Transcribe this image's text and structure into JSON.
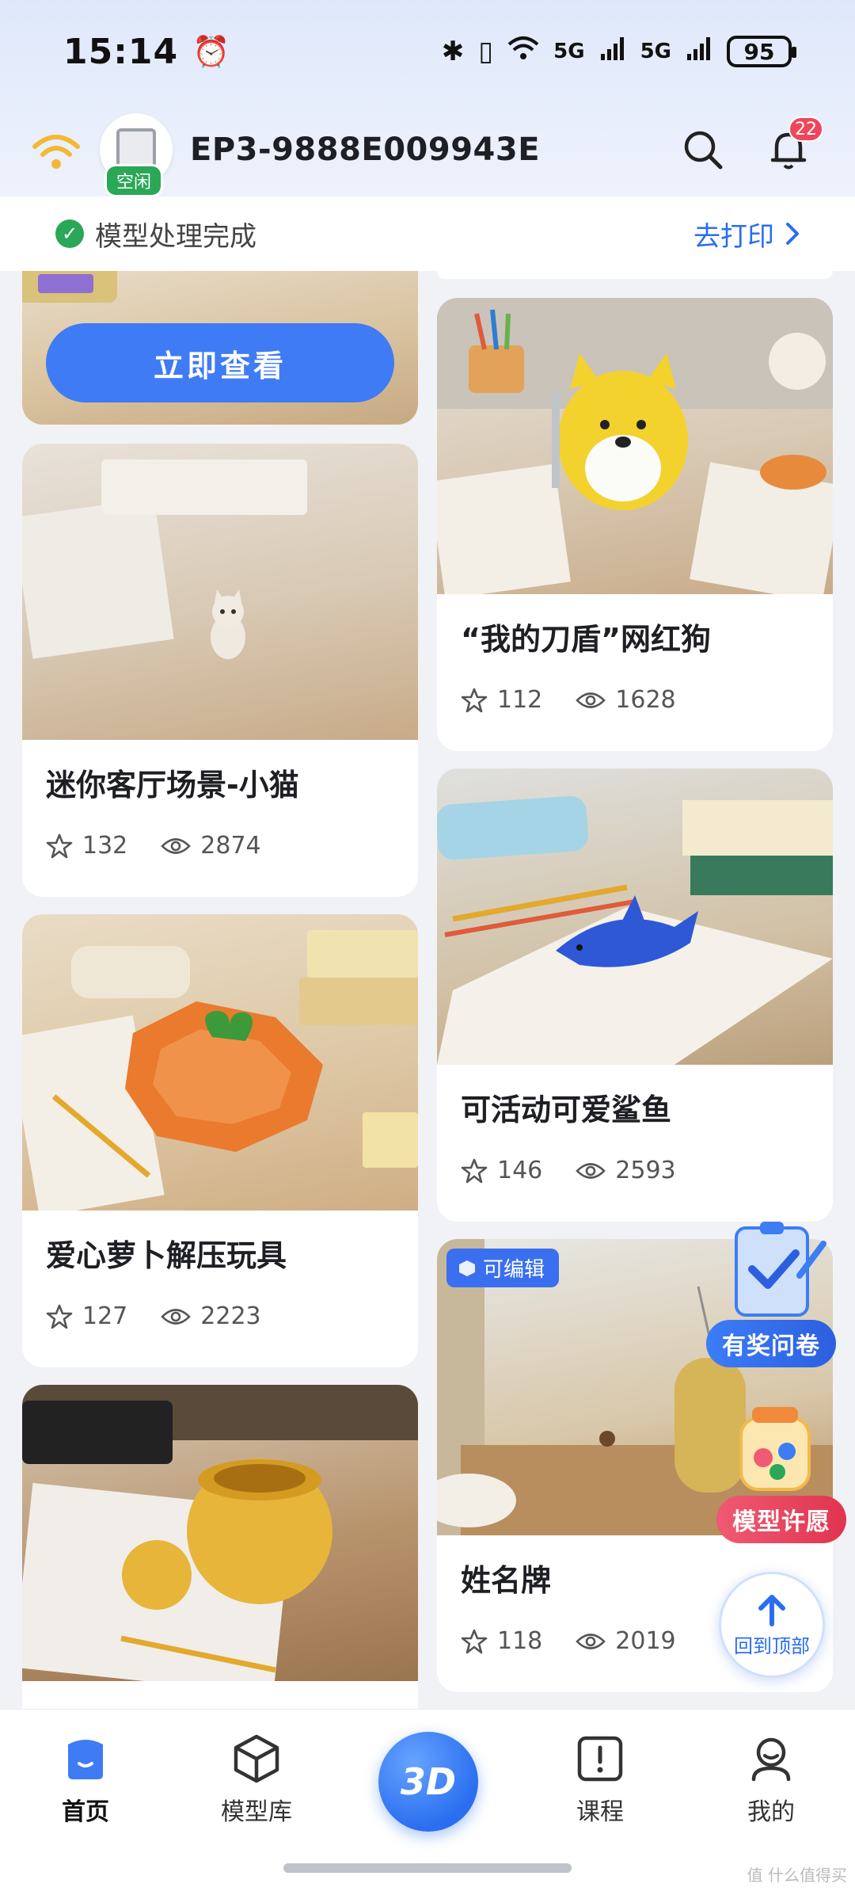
{
  "status_bar": {
    "time": "15:14",
    "network_1": "5G",
    "network_2": "5G",
    "battery": "95"
  },
  "header": {
    "device_name": "EP3-9888E009943E",
    "device_status": "空闲",
    "notification_count": "22"
  },
  "process_banner": {
    "text": "模型处理完成",
    "action_label": "去打印"
  },
  "feed": {
    "top_card_button": "立即查看",
    "left_cards": [
      {
        "title": "迷你客厅场景-小猫",
        "stars": "132",
        "views": "2874"
      },
      {
        "title": "爱心萝卜解压玩具",
        "stars": "127",
        "views": "2223"
      }
    ],
    "right_cards": [
      {
        "title": "“我的刀盾”网红狗",
        "stars": "112",
        "views": "1628"
      },
      {
        "title": "可活动可爱鲨鱼",
        "stars": "146",
        "views": "2593"
      },
      {
        "title": "姓名牌",
        "stars": "118",
        "views": "2019",
        "tag": "可编辑"
      }
    ]
  },
  "floating": {
    "survey_label": "有奖问卷",
    "wish_label": "模型许愿",
    "back_to_top_label": "回到顶部"
  },
  "bottom_nav": {
    "items": [
      {
        "label": "首页",
        "icon": "home-icon",
        "active": true
      },
      {
        "label": "模型库",
        "icon": "cube-icon",
        "active": false
      },
      {
        "label": "3D",
        "icon": "3d-icon",
        "active": false
      },
      {
        "label": "课程",
        "icon": "course-icon",
        "active": false
      },
      {
        "label": "我的",
        "icon": "profile-icon",
        "active": false
      }
    ]
  },
  "watermark": "值 什么值得买",
  "colors": {
    "accent": "#3f7bf4",
    "success": "#2aa757",
    "badge_red": "#f0455a"
  }
}
